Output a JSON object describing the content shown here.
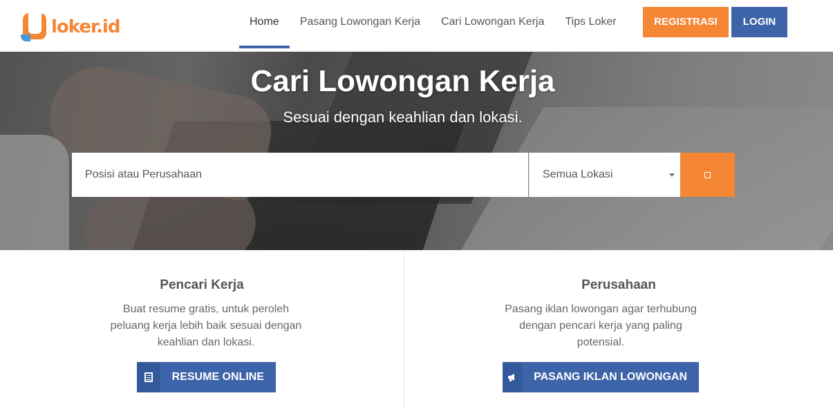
{
  "brand": {
    "name": "loker.id",
    "color": "#f58634",
    "accent": "#4a98d3"
  },
  "nav": {
    "items": [
      {
        "label": "Home",
        "active": true
      },
      {
        "label": "Pasang Lowongan Kerja",
        "active": false
      },
      {
        "label": "Cari Lowongan Kerja",
        "active": false
      },
      {
        "label": "Tips Loker",
        "active": false
      }
    ],
    "register_label": "REGISTRASI",
    "login_label": "LOGIN"
  },
  "hero": {
    "title": "Cari Lowongan Kerja",
    "subtitle": "Sesuai dengan keahlian dan lokasi.",
    "search_placeholder": "Posisi atau Perusahaan",
    "search_value": "",
    "location_selected": "Semua Lokasi",
    "search_icon": "search-icon"
  },
  "panels": {
    "job_seeker": {
      "title": "Pencari Kerja",
      "description": "Buat resume gratis, untuk peroleh peluang kerja lebih baik sesuai dengan keahlian dan lokasi.",
      "button_label": "RESUME ONLINE",
      "button_icon": "document-icon"
    },
    "company": {
      "title": "Perusahaan",
      "description": "Pasang iklan lowongan agar terhubung dengan pencari kerja yang paling potensial.",
      "button_label": "PASANG IKLAN LOWONGAN",
      "button_icon": "megaphone-icon"
    }
  },
  "colors": {
    "primary_blue": "#3d64a8",
    "orange": "#f58634"
  }
}
